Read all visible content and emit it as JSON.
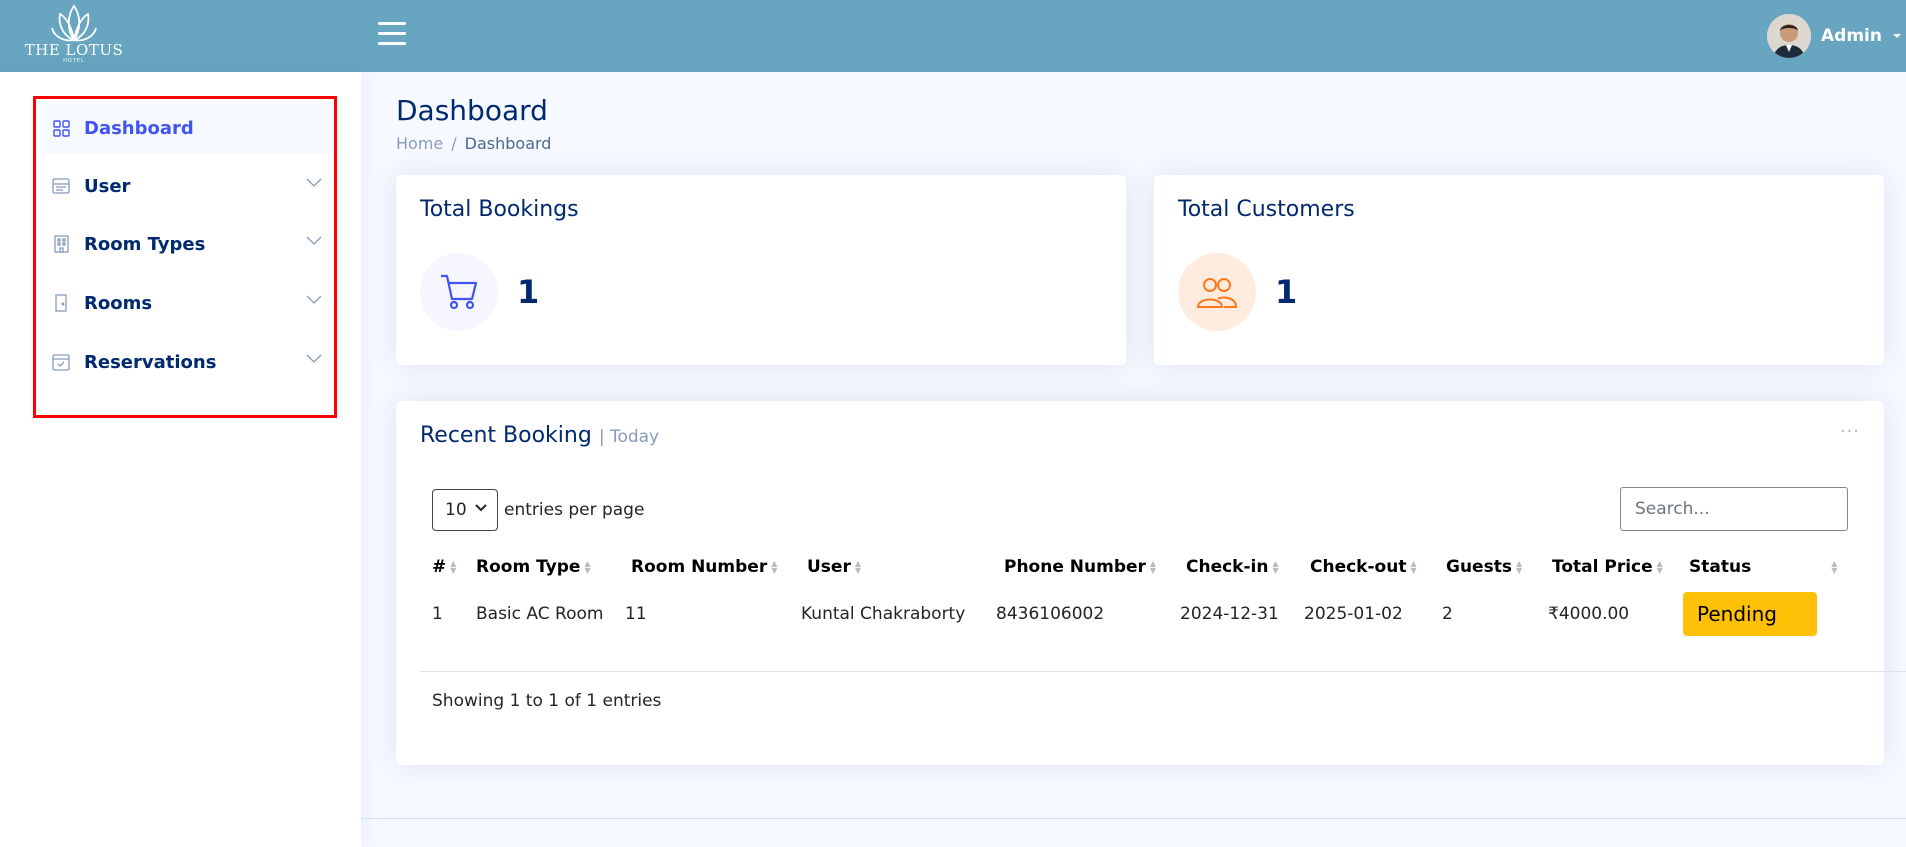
{
  "brand": {
    "name": "THE LOTUS",
    "sub": "HOTEL"
  },
  "user": {
    "name": "Admin"
  },
  "sidebar": {
    "items": [
      {
        "label": "Dashboard",
        "icon": "grid-icon",
        "active": true
      },
      {
        "label": "User",
        "icon": "card-list-icon"
      },
      {
        "label": "Room Types",
        "icon": "building-icon"
      },
      {
        "label": "Rooms",
        "icon": "door-icon"
      },
      {
        "label": "Reservations",
        "icon": "calendar-check-icon"
      }
    ]
  },
  "page": {
    "title": "Dashboard",
    "breadcrumb": [
      "Home",
      "/",
      "Dashboard"
    ]
  },
  "stats": {
    "bookings": {
      "title": "Total Bookings",
      "value": "1",
      "icon": "cart-icon",
      "color": "#4154f1"
    },
    "customers": {
      "title": "Total Customers",
      "value": "1",
      "icon": "people-icon",
      "color": "#ff771d"
    }
  },
  "recent": {
    "title": "Recent Booking",
    "filter": "| Today",
    "more": "···",
    "per_page_value": "10",
    "per_page_label": "entries per page",
    "search_placeholder": "Search...",
    "columns": [
      "#",
      "Room Type",
      "Room Number",
      "User",
      "Phone Number",
      "Check-in",
      "Check-out",
      "Guests",
      "Total Price",
      "Status"
    ],
    "rows": [
      {
        "num": "1",
        "room_type": "Basic AC Room",
        "room_number": "11",
        "user": "Kuntal Chakraborty",
        "phone": "8436106002",
        "checkin": "2024-12-31",
        "checkout": "2025-01-02",
        "guests": "2",
        "price": "₹4000.00",
        "status": "Pending"
      }
    ],
    "showing": "Showing 1 to 1 of 1 entries"
  },
  "colors": {
    "topbar": "#67a5c0",
    "accent": "#4154f1",
    "pending": "#ffc107",
    "highlight_border": "#ff0000"
  }
}
